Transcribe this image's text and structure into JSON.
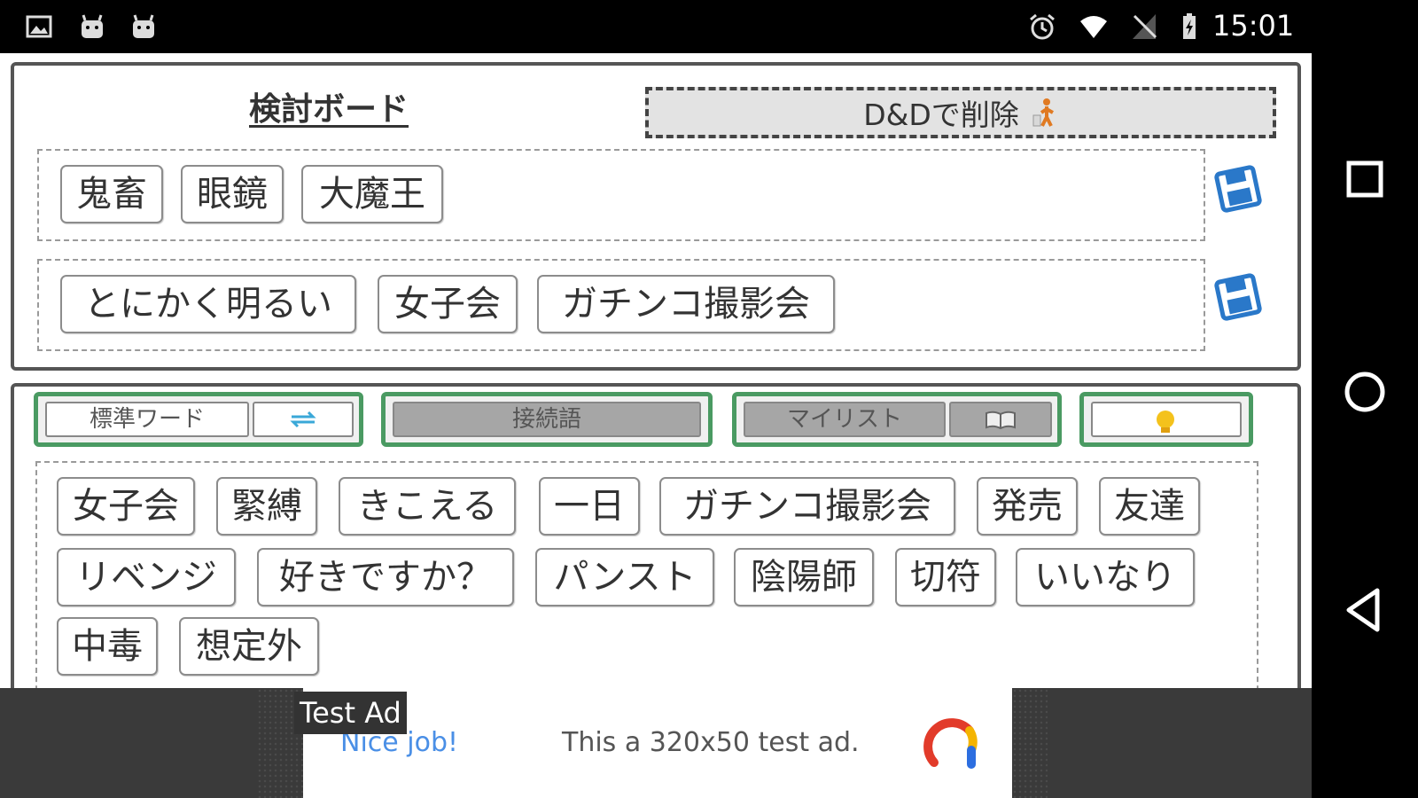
{
  "status_bar": {
    "time": "15:01",
    "left_icons": [
      "gallery-icon",
      "android-icon",
      "android-icon"
    ],
    "right_icons": [
      "alarm-icon",
      "wifi-icon",
      "no-signal-icon",
      "battery-charging-icon"
    ]
  },
  "board": {
    "title": "検討ボード",
    "delete_zone_label": "D&Dで削除",
    "rows": [
      {
        "chips": [
          "鬼畜",
          "眼鏡",
          "大魔王"
        ]
      },
      {
        "chips": [
          "とにかく明るい",
          "女子会",
          "ガチンコ撮影会"
        ]
      }
    ]
  },
  "tabs": [
    {
      "label": "標準ワード",
      "icon": "refresh-icon",
      "state": "active"
    },
    {
      "label": "接続語",
      "state": "inactive"
    },
    {
      "label": "マイリスト",
      "icon": "book-icon",
      "state": "inactive"
    },
    {
      "icon": "lightbulb-icon",
      "state": "active"
    }
  ],
  "words": {
    "rows": [
      [
        "女子会",
        "緊縛",
        "きこえる",
        "一日",
        "ガチンコ撮影会",
        "発売",
        "友達"
      ],
      [
        "リベンジ",
        "好きですか？",
        "パンスト",
        "陰陽師",
        "切符",
        "いいなり"
      ],
      [
        "中毒",
        "想定外"
      ]
    ]
  },
  "ad": {
    "badge": "Test Ad",
    "headline": "Nice job!",
    "text": "This a 320x50 test ad."
  },
  "colors": {
    "tab_border": "#4a9a62",
    "save_icon": "#2a78c9",
    "delete_figure": "#e07a22",
    "ad_link": "#4a8fe6"
  }
}
